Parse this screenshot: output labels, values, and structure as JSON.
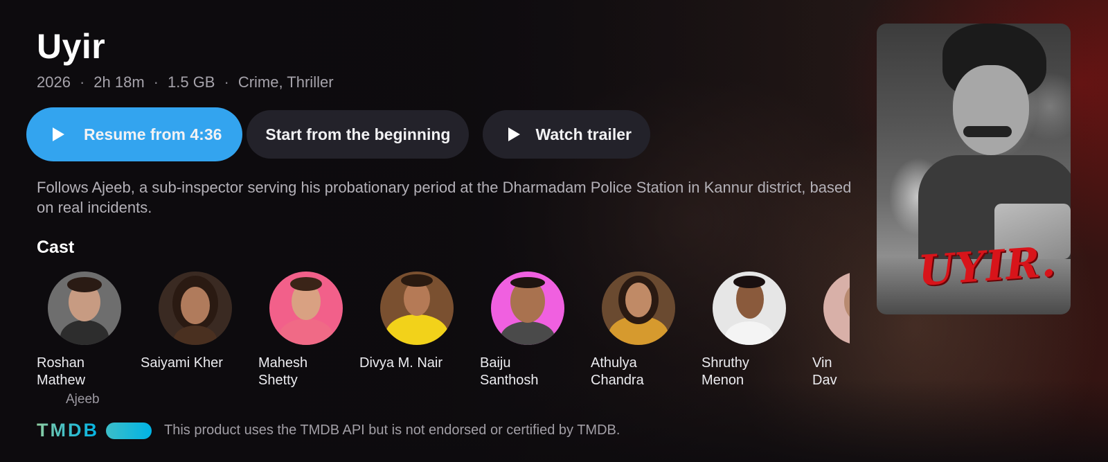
{
  "movie": {
    "title": "Uyir",
    "year": "2026",
    "runtime": "2h 18m",
    "size": "1.5 GB",
    "genres": "Crime, Thriller",
    "separator": "·",
    "overview": "Follows Ajeeb, a sub-inspector serving his probationary period at the Dharmadam Police Station in Kannur district, based on real incidents.",
    "poster_title": "UYIR."
  },
  "actions": {
    "resume_label": "Resume from 4:36",
    "start_label": "Start from the beginning",
    "trailer_label": "Watch trailer",
    "play_icon": "play-icon"
  },
  "cast": {
    "heading": "Cast",
    "members": [
      {
        "name": "Roshan Mathew",
        "role": "Ajeeb",
        "avatar_bg": "#6e6e6e"
      },
      {
        "name": "Saiyami Kher",
        "role": "",
        "avatar_bg": "#3a2a22"
      },
      {
        "name": "Mahesh Shetty",
        "role": "",
        "avatar_bg": "#f2608a"
      },
      {
        "name": "Divya M. Nair",
        "role": "",
        "avatar_bg": "#7a5030"
      },
      {
        "name": "Baiju Santhosh",
        "role": "",
        "avatar_bg": "#f060e0"
      },
      {
        "name": "Athulya Chandra",
        "role": "",
        "avatar_bg": "#6a4a30"
      },
      {
        "name": "Shruthy Menon",
        "role": "",
        "avatar_bg": "#e6e6e6"
      },
      {
        "name": "Vin Dav",
        "role": "",
        "avatar_bg": "#d8b0a8"
      }
    ]
  },
  "footer": {
    "logo_text": "TMDB",
    "attribution": "This product uses the TMDB API but is not endorsed or certified by TMDB."
  },
  "colors": {
    "accent": "#33a4ef",
    "button_bg": "#23222a",
    "background": "#0f0c10"
  }
}
